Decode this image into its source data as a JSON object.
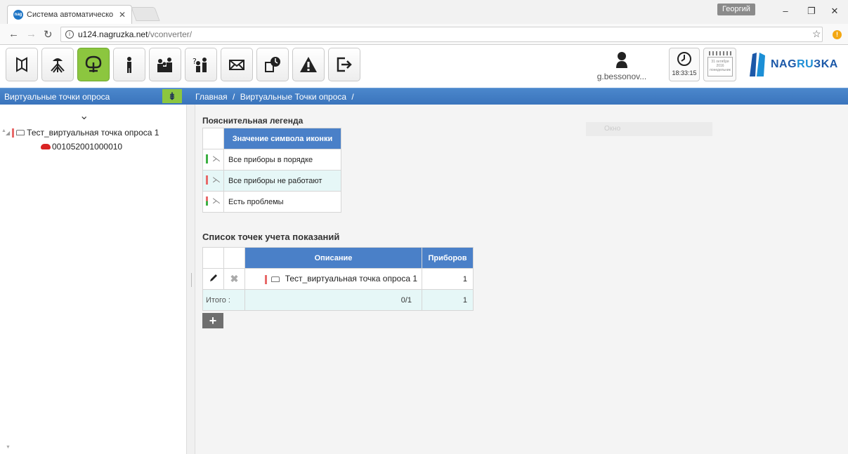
{
  "browser": {
    "tab_title": "Система автоматическо",
    "tab_close": "✕",
    "favicon_text": "nag",
    "window_user": "Георгий",
    "url_host": "u124.nagruzka.net",
    "url_path": "/vconverter/"
  },
  "toolbar": {
    "user_name": "g.bessonov...",
    "clock_time": "18:33:15",
    "calendar_text": "31 октября 2016 понедельник",
    "logo_prefix": "NAG",
    "logo_highlight": "RU",
    "logo_suffix": "ЗKA",
    "icons": [
      "book-icon",
      "network-icon",
      "tree-icon",
      "person-icon",
      "group-icon",
      "users-question-icon",
      "mail-icon",
      "schedule-icon",
      "warning-icon",
      "logout-icon"
    ]
  },
  "left_panel": {
    "title": "Виртуальные точки опроса",
    "pin_label": "⇟",
    "chevron": "⌄",
    "tree": {
      "root_label": "Тест_виртуальная точка опроса 1",
      "child_label": "001052001000010"
    }
  },
  "breadcrumb": {
    "home": "Главная",
    "sep1": "/",
    "current": "Виртуальные Точки опроса",
    "sep2": "/"
  },
  "legend": {
    "title": "Пояснительная легенда",
    "header": "Значение символа иконки",
    "rows": [
      {
        "label": "Все приборы в порядке",
        "color": "#3cb043"
      },
      {
        "label": "Все приборы не работают",
        "color": "#e86a6a"
      },
      {
        "label": "Есть проблемы",
        "color": "#3cb043"
      }
    ]
  },
  "okno_label": "Окно",
  "list": {
    "title": "Список точек учета показаний",
    "col_desc": "Описание",
    "col_count": "Приборов",
    "row": {
      "desc": "Тест_виртуальная точка опроса 1",
      "count": "1"
    },
    "total_label": "Итого :",
    "total_ratio": "0/1",
    "total_count": "1"
  },
  "colors": {
    "accent_green": "#8cc63f",
    "header_blue": "#4a80c8",
    "status_red": "#e86a6a",
    "status_green": "#3cb043"
  }
}
